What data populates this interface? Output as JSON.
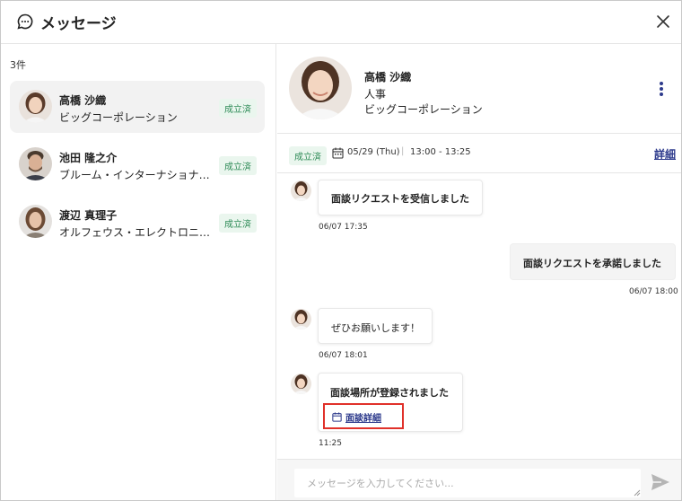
{
  "header": {
    "title": "メッセージ",
    "icon": "chat-bubble-icon",
    "close_icon": "close-icon"
  },
  "conversations": {
    "count_label": "3件",
    "items": [
      {
        "name": "高橋 沙織",
        "company": "ビッグコーポレーション",
        "status": "成立済",
        "active": true
      },
      {
        "name": "池田 隆之介",
        "company": "ブルーム・インターナショナル…",
        "status": "成立済",
        "active": false
      },
      {
        "name": "渡辺 真理子",
        "company": "オルフェウス・エレクトロニク…",
        "status": "成立済",
        "active": false
      }
    ]
  },
  "profile": {
    "name": "高橋 沙織",
    "department": "人事",
    "company": "ビッグコーポレーション",
    "menu_icon": "kebab-menu-icon"
  },
  "meeting": {
    "status": "成立済",
    "date": "05/29 (Thu)",
    "separator": "|",
    "time": "13:00 - 13:25",
    "detail_link": "詳細",
    "icon": "calendar-icon"
  },
  "messages": [
    {
      "sender": "other",
      "text": "面談リクエストを受信しました",
      "time": "06/07 17:35"
    },
    {
      "sender": "me",
      "text": "面談リクエストを承諾しました",
      "time": "06/07 18:00"
    },
    {
      "sender": "other",
      "text": "ぜひお願いします！",
      "time": "06/07 18:01"
    },
    {
      "sender": "other",
      "text": "面談場所が登録されました",
      "link": "面談詳細",
      "time": "11:25"
    }
  ],
  "composer": {
    "placeholder": "メッセージを入力してください...",
    "send_icon": "send-icon"
  },
  "colors": {
    "accent": "#2d3a8c",
    "status_green": "#2e8b57",
    "highlight_red": "#e0312a"
  }
}
